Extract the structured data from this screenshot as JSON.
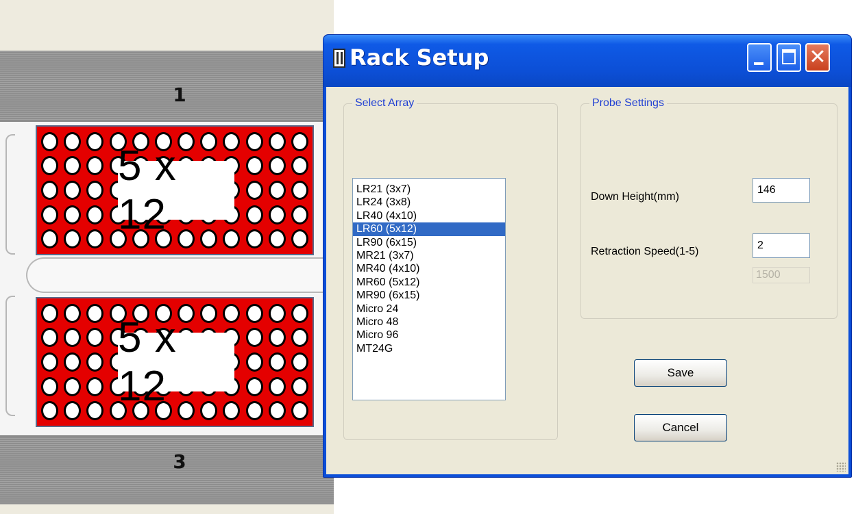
{
  "rack_view": {
    "position_top": "1",
    "position_bottom": "3",
    "array_top_label": "5 x 12",
    "array_bottom_label": "5 x 12",
    "rows": 5,
    "cols": 12,
    "array_color": "#e40000"
  },
  "dialog": {
    "title": "Rack Setup",
    "window_buttons": [
      "minimize-icon",
      "maximize-icon",
      "close-icon"
    ],
    "close_glyph": "✕",
    "select_array": {
      "legend": "Select Array",
      "items": [
        "LR21 (3x7)",
        "LR24 (3x8)",
        "LR40 (4x10)",
        "LR60 (5x12)",
        "LR90 (6x15)",
        "MR21 (3x7)",
        "MR40 (4x10)",
        "MR60 (5x12)",
        "MR90 (6x15)",
        "Micro 24",
        "Micro 48",
        "Micro 96",
        "MT24G"
      ],
      "selected_index": 3
    },
    "probe_settings": {
      "legend": "Probe Settings",
      "down_height_label": "Down Height(mm)",
      "down_height_value": "146",
      "retraction_speed_label": "Retraction Speed(1-5)",
      "retraction_speed_value": "2",
      "disabled_value": "1500"
    },
    "save_label": "Save",
    "cancel_label": "Cancel"
  },
  "colors": {
    "titlebar": "#0c4fd6",
    "selection": "#316ac5",
    "legend_text": "#1f3fd3",
    "close_button": "#c9401d"
  }
}
